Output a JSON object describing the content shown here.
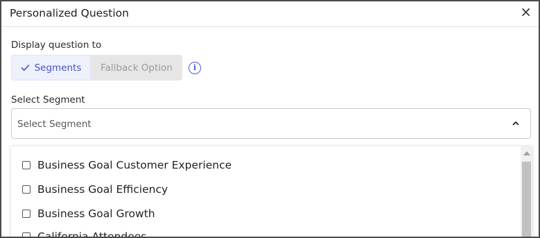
{
  "dialog": {
    "title": "Personalized Question",
    "close_glyph": "×"
  },
  "display": {
    "label": "Display question to",
    "toggle": {
      "selected_label": "Segments",
      "other_label": "Fallback Option"
    },
    "info_glyph": "i"
  },
  "segment": {
    "label": "Select Segment",
    "placeholder": "Select Segment",
    "options": [
      "Business Goal Customer Experience",
      "Business Goal Efficiency",
      "Business Goal Growth",
      "California Attendees"
    ]
  },
  "colors": {
    "accent": "#4455c8",
    "selected_bg": "#eef0fb",
    "unselected_bg": "#e6e6e6"
  }
}
